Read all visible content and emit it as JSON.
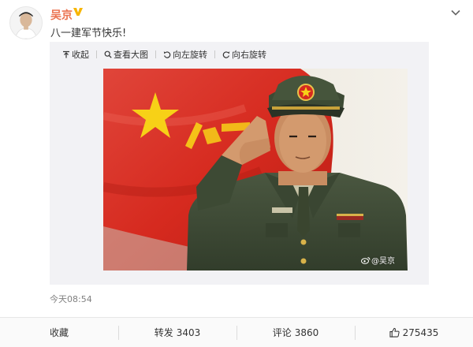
{
  "post": {
    "author": "吴京",
    "text": "八一建军节快乐!",
    "timestamp": "今天08:54"
  },
  "media_toolbar": {
    "collapse": "收起",
    "view_large": "查看大图",
    "rotate_left": "向左旋转",
    "rotate_right": "向右旋转"
  },
  "photo": {
    "watermark": "@吴京"
  },
  "footer": {
    "favorite_label": "收藏",
    "repost_label": "转发",
    "repost_count": "3403",
    "comment_label": "评论",
    "comment_count": "3860",
    "like_count": "275435"
  },
  "colors": {
    "author_name": "#eb7350",
    "verified_badge": "#f7b500",
    "media_bg": "#f2f2f5",
    "flag_red": "#d62a1f",
    "flag_star": "#f7d117",
    "uniform_green": "#3d4a34"
  },
  "icons": {
    "verified": "verified-v-icon",
    "menu": "chevron-down-icon",
    "collapse": "arrow-up-icon",
    "view_large": "magnifier-icon",
    "rotate_left": "rotate-left-icon",
    "rotate_right": "rotate-right-icon",
    "like": "thumbs-up-icon"
  }
}
